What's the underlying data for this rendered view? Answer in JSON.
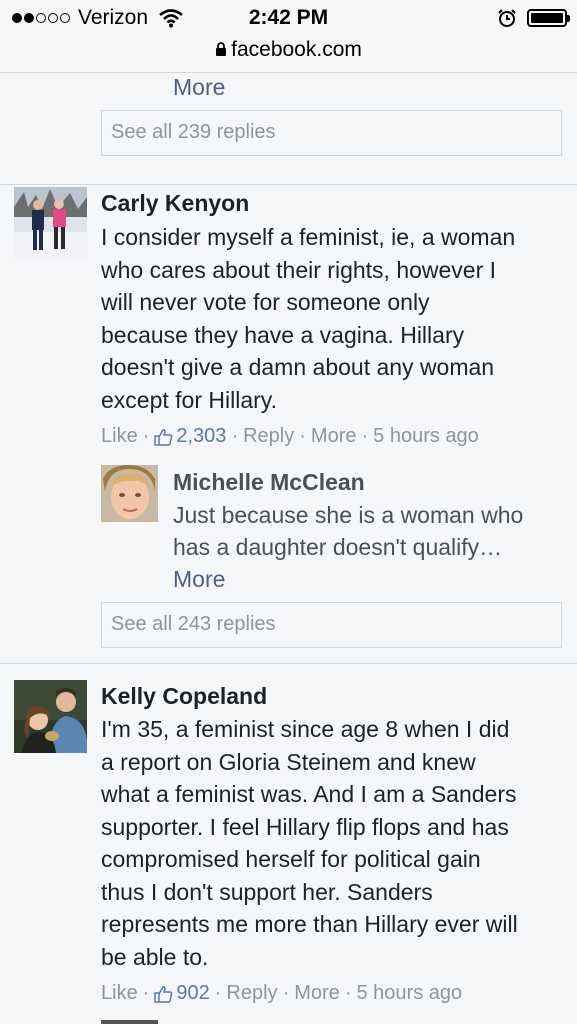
{
  "status_bar": {
    "carrier": "Verizon",
    "time": "2:42 PM",
    "url": "facebook.com"
  },
  "top_reply": {
    "more": "More",
    "see_all": "See all 239 replies"
  },
  "comments": [
    {
      "name": "Carly Kenyon",
      "text_lines": [
        "I consider myself a feminist, ie, a woman",
        "who cares about their rights, however I",
        "will never vote for someone only",
        "because they have a vagina. Hillary",
        "doesn't give a damn about any woman",
        "except for Hillary."
      ],
      "like": "Like",
      "likes": "2,303",
      "reply": "Reply",
      "more": "More",
      "time": "5 hours ago",
      "reply_preview": {
        "name": "Michelle McClean",
        "text_lines": [
          "Just because she is a woman who",
          "has a daughter doesn't qualify…"
        ],
        "more": "More"
      },
      "see_all": "See all 243 replies"
    },
    {
      "name": "Kelly Copeland",
      "text_lines": [
        "I'm 35, a feminist since age 8 when I did",
        "a report on Gloria Steinem and knew",
        "what a feminist was. And I am a Sanders",
        "supporter. I feel Hillary flip flops and has",
        "compromised herself for political gain",
        "thus I don't support her. Sanders",
        "represents me more than Hillary ever will",
        "be able to."
      ],
      "like": "Like",
      "likes": "902",
      "reply": "Reply",
      "more": "More",
      "time": "5 hours ago"
    }
  ],
  "colors": {
    "link": "#4b5f8f",
    "meta": "#90949c",
    "border": "#d3d6db",
    "bg": "#f6f7f9"
  }
}
